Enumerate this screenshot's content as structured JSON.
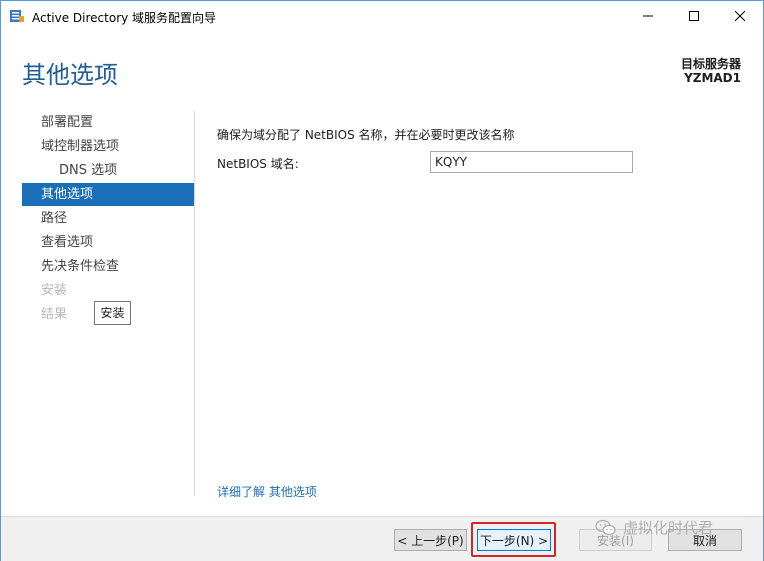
{
  "window": {
    "title": "Active Directory 域服务配置向导",
    "minimize_glyph": "—",
    "maximize_glyph": "□",
    "close_glyph": "✕"
  },
  "header": {
    "page_title": "其他选项",
    "target_label": "目标服务器",
    "target_name": "YZMAD1"
  },
  "nav": {
    "items": [
      {
        "label": "部署配置",
        "state": "normal"
      },
      {
        "label": "域控制器选项",
        "state": "normal"
      },
      {
        "label": "DNS 选项",
        "state": "sub"
      },
      {
        "label": "其他选项",
        "state": "active"
      },
      {
        "label": "路径",
        "state": "normal"
      },
      {
        "label": "查看选项",
        "state": "normal"
      },
      {
        "label": "先决条件检查",
        "state": "normal"
      },
      {
        "label": "安装",
        "state": "disabled"
      },
      {
        "label": "结果",
        "state": "disabled"
      }
    ],
    "tooltip": "安装"
  },
  "content": {
    "description": "确保为域分配了 NetBIOS 名称，并在必要时更改该名称",
    "netbios_label": "NetBIOS 域名:",
    "netbios_value": "KQYY",
    "learn_more": "详细了解 其他选项"
  },
  "footer": {
    "prev_label": "< 上一步(P)",
    "next_label": "下一步(N) >",
    "install_label": "安装(I)",
    "cancel_label": "取消"
  },
  "watermark": {
    "text": "虚拟化时代君",
    "icon": "wechat-icon"
  },
  "colors": {
    "accent": "#1a6fb8",
    "title_blue": "#1f5e96",
    "highlight_red": "#d4252a",
    "footer_bg": "#f0f0f0"
  }
}
